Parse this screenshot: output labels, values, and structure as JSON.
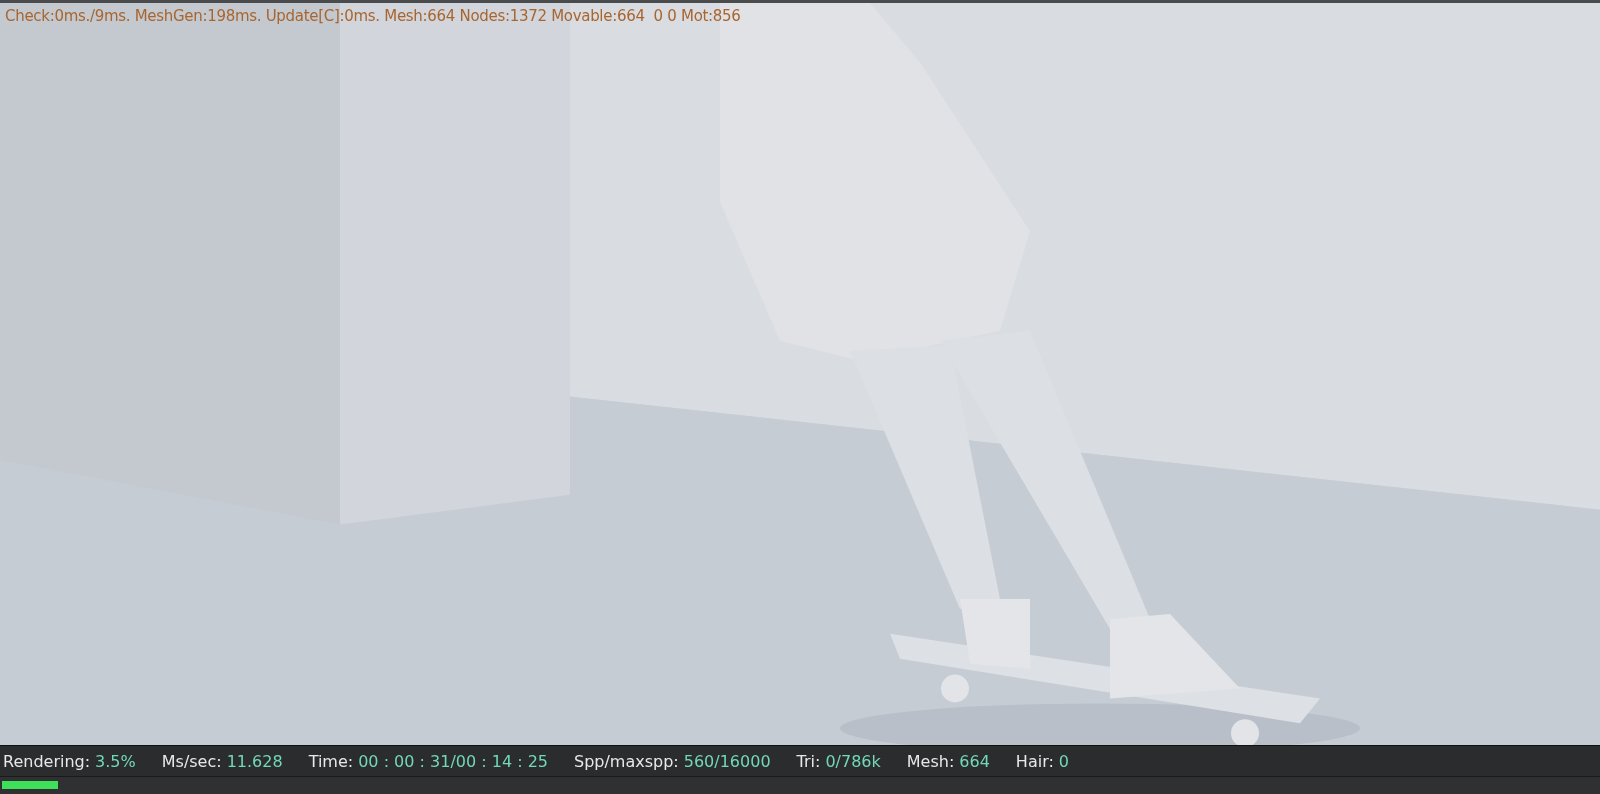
{
  "viewport": {
    "kind": "picture",
    "overlay_text": "Check:0ms./9ms. MeshGen:198ms. Update[C]:0ms. Mesh:664 Nodes:1372 Movable:664  0 0 Mot:856"
  },
  "status_bar": {
    "stats": [
      {
        "label": "Rendering:",
        "value": "3.5%"
      },
      {
        "label": "Ms/sec:",
        "value": "11.628"
      },
      {
        "label": "Time:",
        "value": "00 : 00 : 31/00 : 14 : 25"
      },
      {
        "label": "Spp/maxspp:",
        "value": "560/16000"
      },
      {
        "label": "Tri:",
        "value": "0/786k"
      },
      {
        "label": "Mesh:",
        "value": "664"
      },
      {
        "label": "Hair:",
        "value": "0"
      }
    ]
  },
  "progress": {
    "level": 0.035
  }
}
